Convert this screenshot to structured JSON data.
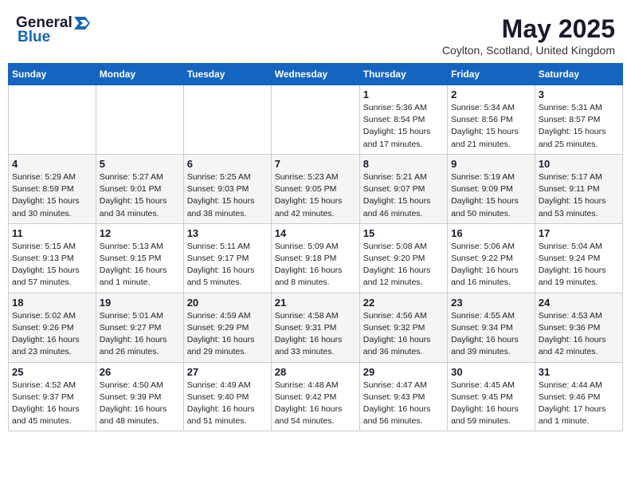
{
  "logo": {
    "general": "General",
    "blue": "Blue"
  },
  "title": "May 2025",
  "location": "Coylton, Scotland, United Kingdom",
  "weekdays": [
    "Sunday",
    "Monday",
    "Tuesday",
    "Wednesday",
    "Thursday",
    "Friday",
    "Saturday"
  ],
  "weeks": [
    [
      {
        "day": "",
        "detail": ""
      },
      {
        "day": "",
        "detail": ""
      },
      {
        "day": "",
        "detail": ""
      },
      {
        "day": "",
        "detail": ""
      },
      {
        "day": "1",
        "detail": "Sunrise: 5:36 AM\nSunset: 8:54 PM\nDaylight: 15 hours and 17 minutes."
      },
      {
        "day": "2",
        "detail": "Sunrise: 5:34 AM\nSunset: 8:56 PM\nDaylight: 15 hours and 21 minutes."
      },
      {
        "day": "3",
        "detail": "Sunrise: 5:31 AM\nSunset: 8:57 PM\nDaylight: 15 hours and 25 minutes."
      }
    ],
    [
      {
        "day": "4",
        "detail": "Sunrise: 5:29 AM\nSunset: 8:59 PM\nDaylight: 15 hours and 30 minutes."
      },
      {
        "day": "5",
        "detail": "Sunrise: 5:27 AM\nSunset: 9:01 PM\nDaylight: 15 hours and 34 minutes."
      },
      {
        "day": "6",
        "detail": "Sunrise: 5:25 AM\nSunset: 9:03 PM\nDaylight: 15 hours and 38 minutes."
      },
      {
        "day": "7",
        "detail": "Sunrise: 5:23 AM\nSunset: 9:05 PM\nDaylight: 15 hours and 42 minutes."
      },
      {
        "day": "8",
        "detail": "Sunrise: 5:21 AM\nSunset: 9:07 PM\nDaylight: 15 hours and 46 minutes."
      },
      {
        "day": "9",
        "detail": "Sunrise: 5:19 AM\nSunset: 9:09 PM\nDaylight: 15 hours and 50 minutes."
      },
      {
        "day": "10",
        "detail": "Sunrise: 5:17 AM\nSunset: 9:11 PM\nDaylight: 15 hours and 53 minutes."
      }
    ],
    [
      {
        "day": "11",
        "detail": "Sunrise: 5:15 AM\nSunset: 9:13 PM\nDaylight: 15 hours and 57 minutes."
      },
      {
        "day": "12",
        "detail": "Sunrise: 5:13 AM\nSunset: 9:15 PM\nDaylight: 16 hours and 1 minute."
      },
      {
        "day": "13",
        "detail": "Sunrise: 5:11 AM\nSunset: 9:17 PM\nDaylight: 16 hours and 5 minutes."
      },
      {
        "day": "14",
        "detail": "Sunrise: 5:09 AM\nSunset: 9:18 PM\nDaylight: 16 hours and 8 minutes."
      },
      {
        "day": "15",
        "detail": "Sunrise: 5:08 AM\nSunset: 9:20 PM\nDaylight: 16 hours and 12 minutes."
      },
      {
        "day": "16",
        "detail": "Sunrise: 5:06 AM\nSunset: 9:22 PM\nDaylight: 16 hours and 16 minutes."
      },
      {
        "day": "17",
        "detail": "Sunrise: 5:04 AM\nSunset: 9:24 PM\nDaylight: 16 hours and 19 minutes."
      }
    ],
    [
      {
        "day": "18",
        "detail": "Sunrise: 5:02 AM\nSunset: 9:26 PM\nDaylight: 16 hours and 23 minutes."
      },
      {
        "day": "19",
        "detail": "Sunrise: 5:01 AM\nSunset: 9:27 PM\nDaylight: 16 hours and 26 minutes."
      },
      {
        "day": "20",
        "detail": "Sunrise: 4:59 AM\nSunset: 9:29 PM\nDaylight: 16 hours and 29 minutes."
      },
      {
        "day": "21",
        "detail": "Sunrise: 4:58 AM\nSunset: 9:31 PM\nDaylight: 16 hours and 33 minutes."
      },
      {
        "day": "22",
        "detail": "Sunrise: 4:56 AM\nSunset: 9:32 PM\nDaylight: 16 hours and 36 minutes."
      },
      {
        "day": "23",
        "detail": "Sunrise: 4:55 AM\nSunset: 9:34 PM\nDaylight: 16 hours and 39 minutes."
      },
      {
        "day": "24",
        "detail": "Sunrise: 4:53 AM\nSunset: 9:36 PM\nDaylight: 16 hours and 42 minutes."
      }
    ],
    [
      {
        "day": "25",
        "detail": "Sunrise: 4:52 AM\nSunset: 9:37 PM\nDaylight: 16 hours and 45 minutes."
      },
      {
        "day": "26",
        "detail": "Sunrise: 4:50 AM\nSunset: 9:39 PM\nDaylight: 16 hours and 48 minutes."
      },
      {
        "day": "27",
        "detail": "Sunrise: 4:49 AM\nSunset: 9:40 PM\nDaylight: 16 hours and 51 minutes."
      },
      {
        "day": "28",
        "detail": "Sunrise: 4:48 AM\nSunset: 9:42 PM\nDaylight: 16 hours and 54 minutes."
      },
      {
        "day": "29",
        "detail": "Sunrise: 4:47 AM\nSunset: 9:43 PM\nDaylight: 16 hours and 56 minutes."
      },
      {
        "day": "30",
        "detail": "Sunrise: 4:45 AM\nSunset: 9:45 PM\nDaylight: 16 hours and 59 minutes."
      },
      {
        "day": "31",
        "detail": "Sunrise: 4:44 AM\nSunset: 9:46 PM\nDaylight: 17 hours and 1 minute."
      }
    ]
  ]
}
